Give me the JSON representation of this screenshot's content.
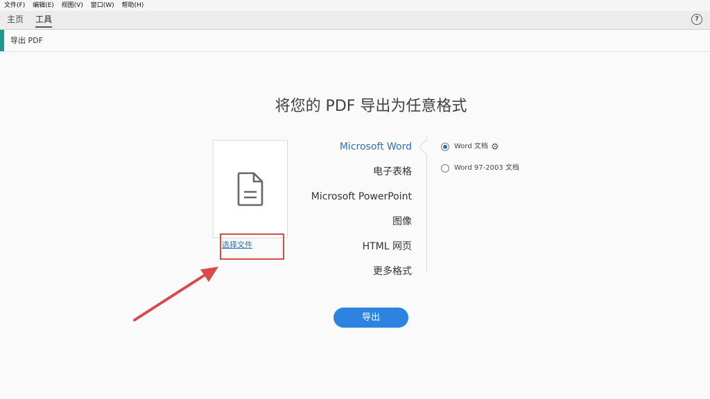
{
  "menu": [
    "文件(F)",
    "编辑(E)",
    "视图(V)",
    "窗口(W)",
    "帮助(H)"
  ],
  "tabs": {
    "home": "主页",
    "tools": "工具"
  },
  "help": "?",
  "tool_title": "导出 PDF",
  "heading": "将您的 PDF 导出为任意格式",
  "choose_file": "选择文件",
  "formats": [
    {
      "label": "Microsoft Word",
      "active": true
    },
    {
      "label": "电子表格",
      "active": false
    },
    {
      "label": "Microsoft PowerPoint",
      "active": false
    },
    {
      "label": "图像",
      "active": false
    },
    {
      "label": "HTML 网页",
      "active": false
    },
    {
      "label": "更多格式",
      "active": false
    }
  ],
  "options": [
    {
      "label": "Word 文档",
      "selected": true,
      "has_settings": true
    },
    {
      "label": "Word 97-2003 文档",
      "selected": false,
      "has_settings": false
    }
  ],
  "export_button": "导出",
  "colors": {
    "accent": "#1e9a8d",
    "link": "#2d6fb5",
    "button": "#2d84e0",
    "annotation": "#d94b4b"
  }
}
